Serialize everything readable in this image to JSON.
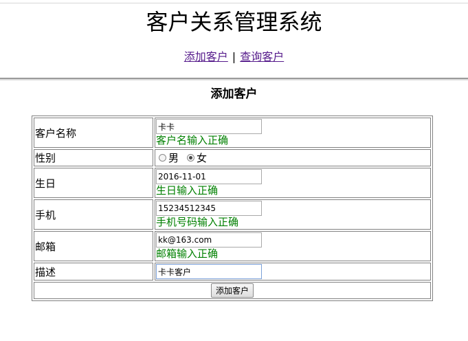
{
  "app_title": "客户关系管理系统",
  "nav": {
    "add_link": "添加客户",
    "separator": "|",
    "query_link": "查询客户"
  },
  "form": {
    "title": "添加客户",
    "rows": {
      "name": {
        "label": "客户名称",
        "value": "卡卡",
        "message": "客户名输入正确"
      },
      "gender": {
        "label": "性别",
        "options": [
          "男",
          "女"
        ],
        "selected": "女"
      },
      "birthday": {
        "label": "生日",
        "value": "2016-11-01",
        "message": "生日输入正确"
      },
      "phone": {
        "label": "手机",
        "value": "15234512345",
        "message": "手机号码输入正确"
      },
      "email": {
        "label": "邮箱",
        "value": "kk@163.com",
        "message": "邮箱输入正确"
      },
      "description": {
        "label": "描述",
        "value": "卡卡客户"
      }
    },
    "submit_label": "添加客户"
  },
  "colors": {
    "success_text": "#008000",
    "visited_link": "#551a8b",
    "border": "#808080"
  }
}
